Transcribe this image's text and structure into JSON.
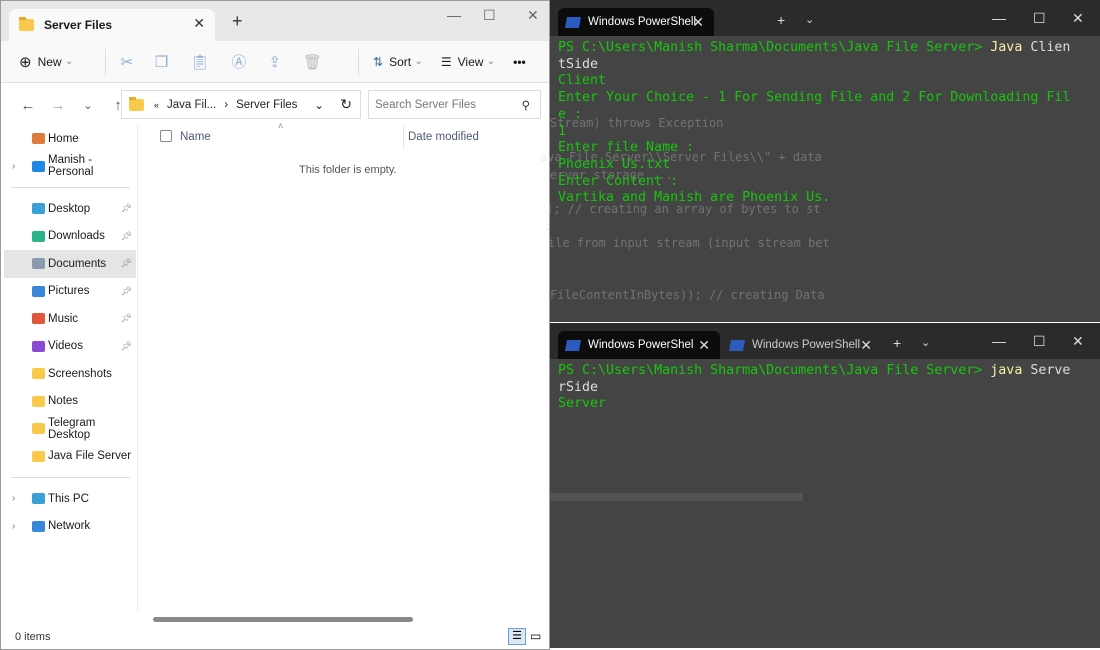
{
  "explorer": {
    "tab_title": "Server Files",
    "toolbar": {
      "new": "New",
      "sort": "Sort",
      "view": "View",
      "more": "•••"
    },
    "breadcrumb": {
      "overflow": "«",
      "parent": "Java Fil...",
      "current": "Server Files"
    },
    "search_placeholder": "Search Server Files",
    "sidebar": [
      {
        "label": "Home",
        "color": "#e07b39"
      },
      {
        "label": "Manish - Personal",
        "color": "#1e88e5"
      }
    ],
    "quick_access": [
      {
        "label": "Desktop",
        "color": "#3aa0d8"
      },
      {
        "label": "Downloads",
        "color": "#2bb38b"
      },
      {
        "label": "Documents",
        "color": "#8a9bb0"
      },
      {
        "label": "Pictures",
        "color": "#3a86d8"
      },
      {
        "label": "Music",
        "color": "#e0573a"
      },
      {
        "label": "Videos",
        "color": "#8a4ad8"
      },
      {
        "label": "Screenshots",
        "color": "#f8c94a"
      },
      {
        "label": "Notes",
        "color": "#f8c94a"
      },
      {
        "label": "Telegram Desktop",
        "color": "#f8c94a"
      },
      {
        "label": "Java File Server",
        "color": "#f8c94a"
      }
    ],
    "devices": [
      {
        "label": "This PC",
        "color": "#3aa0d8"
      },
      {
        "label": "Network",
        "color": "#3a86d8"
      }
    ],
    "columns": {
      "name": "Name",
      "date": "Date modified"
    },
    "empty_text": "This folder is empty.",
    "status": "0 items"
  },
  "terminal_top": {
    "tab": "Windows PowerShell",
    "prompt": "PS C:\\Users\\Manish Sharma\\Documents\\Java File Server> ",
    "cmd": "Java",
    "arg1": " Clien",
    "arg2": "tSide",
    "lines": [
      "Client",
      "Enter Your Choice - 1 For Sending File and 2 For Downloading Fil",
      "e :",
      "1",
      "Enter file Name :",
      "Phoenix Us.txt",
      "Enter Content :",
      "Vartika and Manish are Phoenix Us."
    ],
    "ghost": [
      "Stream) throws Exception",
      "ava File Server\\\\Server Files\\\\\" + data",
      "erver storage....",
      "]; // creating an array of bytes to st",
      ";",
      "ile from input stream (input stream bet",
      "FileContentInBytes)); // creating Data"
    ]
  },
  "terminal_bottom": {
    "tabs": [
      "Windows PowerShel",
      "Windows PowerShell"
    ],
    "prompt": "PS C:\\Users\\Manish Sharma\\Documents\\Java File Server> ",
    "cmd": "java",
    "arg1": " Serve",
    "arg2": "rSide",
    "lines": [
      "Server"
    ]
  }
}
